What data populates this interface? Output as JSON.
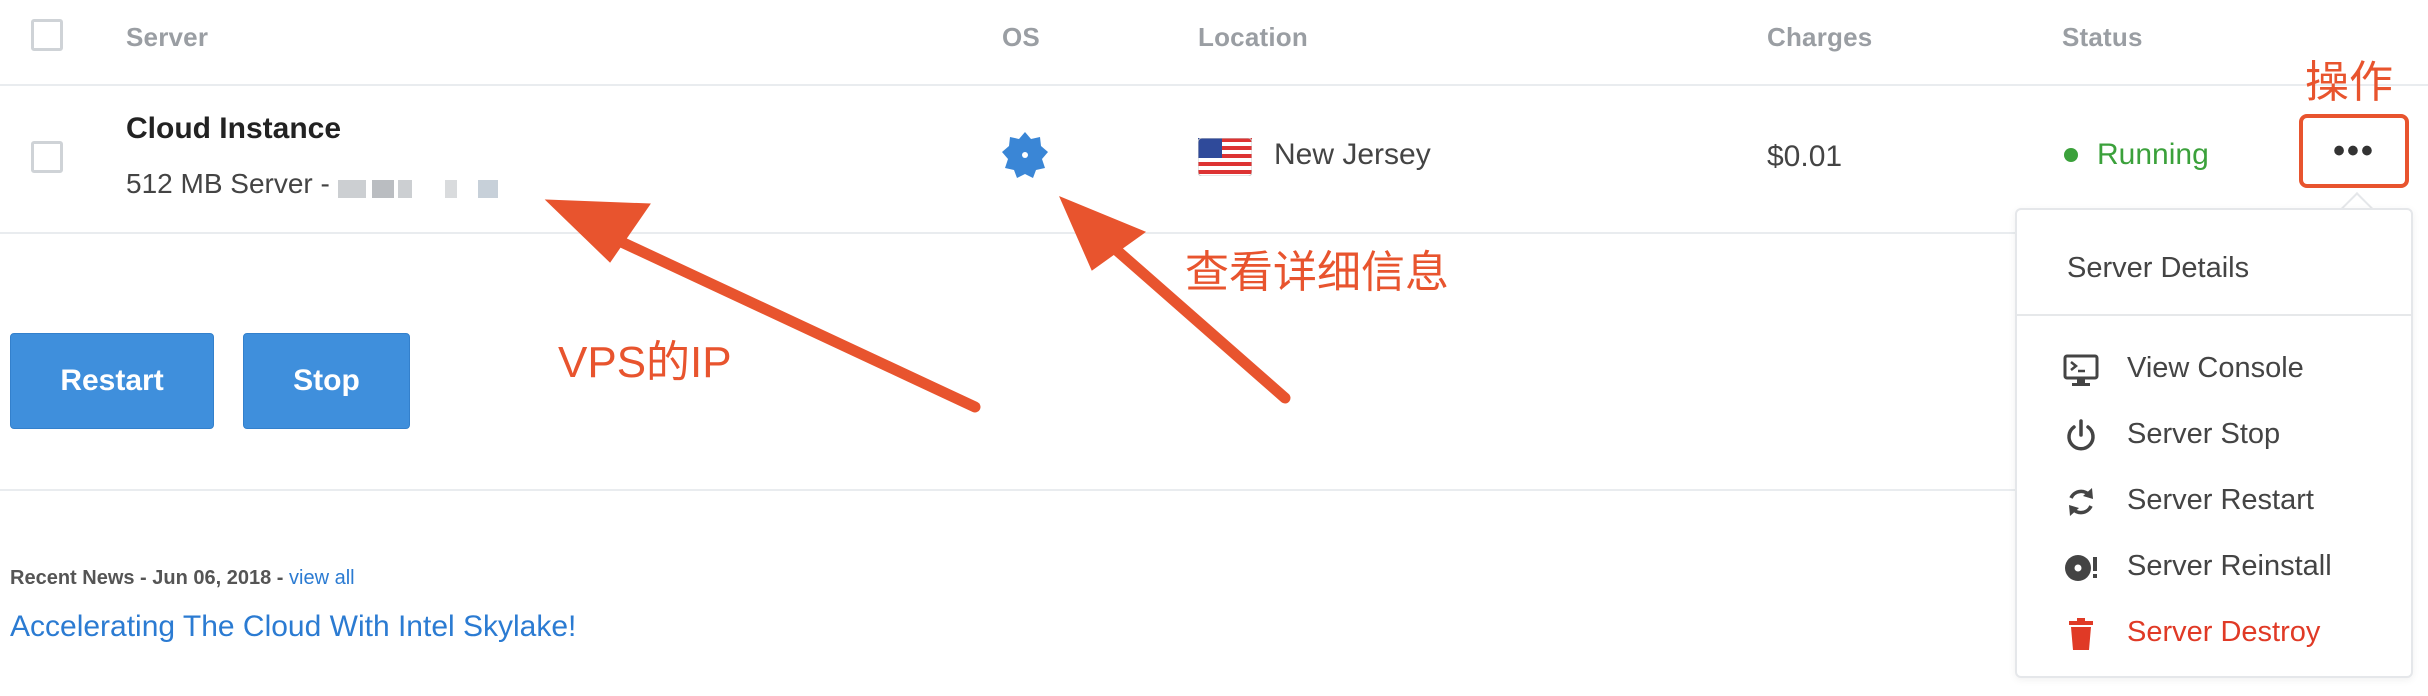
{
  "table": {
    "headers": {
      "server": "Server",
      "os": "OS",
      "location": "Location",
      "charges": "Charges",
      "status": "Status"
    },
    "row": {
      "title": "Cloud Instance",
      "subtitle": "512 MB Server - ",
      "location": "New Jersey",
      "charges": "$0.01",
      "status": "Running",
      "more_label": "•••"
    }
  },
  "actions": {
    "restart_label": "Restart",
    "stop_label": "Stop"
  },
  "news": {
    "meta": "Recent News - Jun 06, 2018 - ",
    "view_all": "view all",
    "link": "Accelerating The Cloud With Intel Skylake!"
  },
  "dropdown": {
    "header": "Server Details",
    "items": [
      {
        "label": "View Console",
        "icon": "console-icon"
      },
      {
        "label": "Server Stop",
        "icon": "power-icon"
      },
      {
        "label": "Server Restart",
        "icon": "restart-icon"
      },
      {
        "label": "Server Reinstall",
        "icon": "reinstall-icon"
      },
      {
        "label": "Server Destroy",
        "icon": "trash-icon",
        "danger": true
      }
    ]
  },
  "annotations": {
    "operation": "操作",
    "view_details": "查看详细信息",
    "vps_ip": "VPS的IP"
  },
  "colors": {
    "accent": "#3f8fdc",
    "running": "#3ba13b",
    "danger": "#e03a26",
    "annotation": "#e8542e"
  }
}
